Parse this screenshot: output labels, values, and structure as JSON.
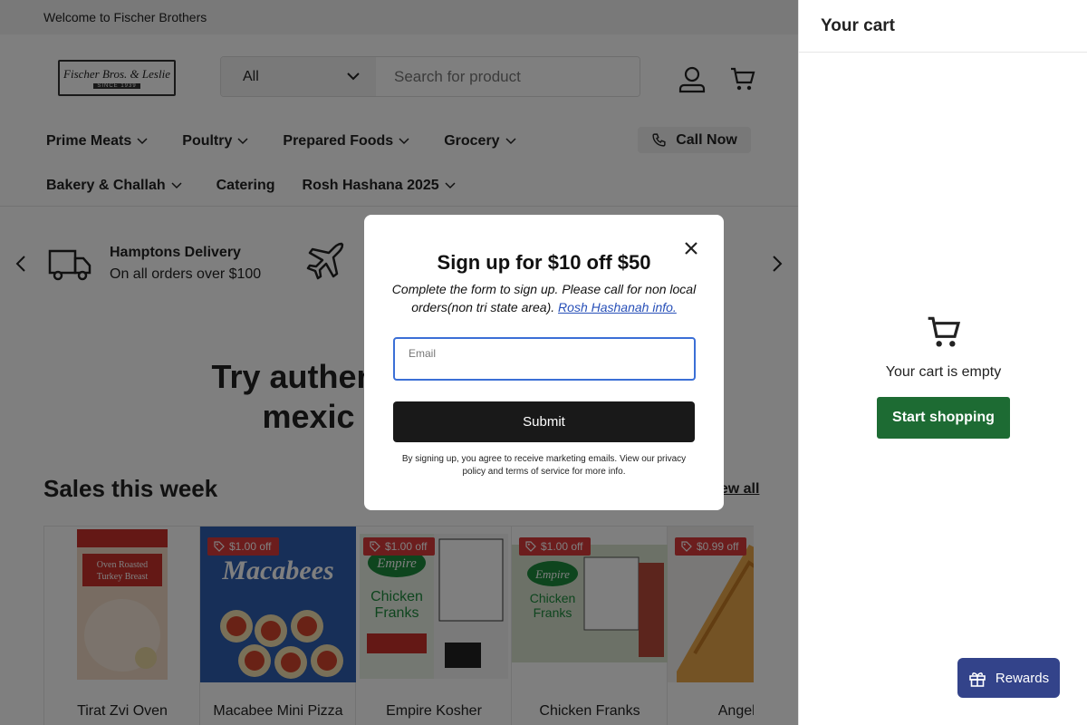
{
  "announcement": "Welcome to Fischer Brothers",
  "header": {
    "logo_text": "Fischer Bros. & Leslie",
    "logo_sub": "SINCE 1939",
    "search_category": "All",
    "search_placeholder": "Search for product"
  },
  "nav": {
    "row1": [
      {
        "label": "Prime Meats",
        "dropdown": true
      },
      {
        "label": "Poultry",
        "dropdown": true
      },
      {
        "label": "Prepared Foods",
        "dropdown": true
      },
      {
        "label": "Grocery",
        "dropdown": true
      }
    ],
    "row2": [
      {
        "label": "Bakery & Challah",
        "dropdown": true
      },
      {
        "label": "Catering",
        "dropdown": false
      },
      {
        "label": "Rosh Hashana 2025",
        "dropdown": true
      }
    ],
    "call_label": "Call Now"
  },
  "usp": {
    "delivery_title": "Hamptons Delivery",
    "delivery_sub": "On all orders over $100"
  },
  "promo": {
    "line1": "Try authentic",
    "line2": "mexic"
  },
  "sales": {
    "title": "Sales this week",
    "view_all": "View all",
    "products": [
      {
        "name": "Tirat Zvi Oven",
        "badge": "",
        "img_label": "Oven Roasted Turkey Breast",
        "img_color": "#f0d9c4"
      },
      {
        "name": "Macabee Mini Pizza",
        "badge": "$1.00 off",
        "img_label": "Macabees",
        "img_color": "#2f5fb0"
      },
      {
        "name": "Empire Kosher",
        "badge": "$1.00 off",
        "img_label": "Chicken Franks",
        "img_color": "#e9f0e4"
      },
      {
        "name": "Chicken Franks",
        "badge": "$1.00 off",
        "img_label": "Chicken Franks",
        "img_color": "#d9e3cf"
      },
      {
        "name": "Angel Cl",
        "badge": "$0.99 off",
        "img_label": "",
        "img_color": "#e8a64a"
      }
    ]
  },
  "cart": {
    "title": "Your cart",
    "empty_text": "Your cart is empty",
    "start_label": "Start shopping"
  },
  "rewards_label": "Rewards",
  "modal": {
    "title": "Sign up for $10 off $50",
    "desc": "Complete the form to sign up. Please call for non local orders(non tri state area).",
    "link": "Rosh Hashanah info.",
    "email_label": "Email",
    "email_value": "",
    "submit_label": "Submit",
    "legal": "By signing up, you agree to receive marketing emails. View our privacy policy and terms of service for more info."
  },
  "colors": {
    "modal_button": "#191919",
    "cart_button": "#1d6b33",
    "rewards": "#33438a",
    "badge": "#d93a3a",
    "input_focus": "#3b6fd6"
  }
}
